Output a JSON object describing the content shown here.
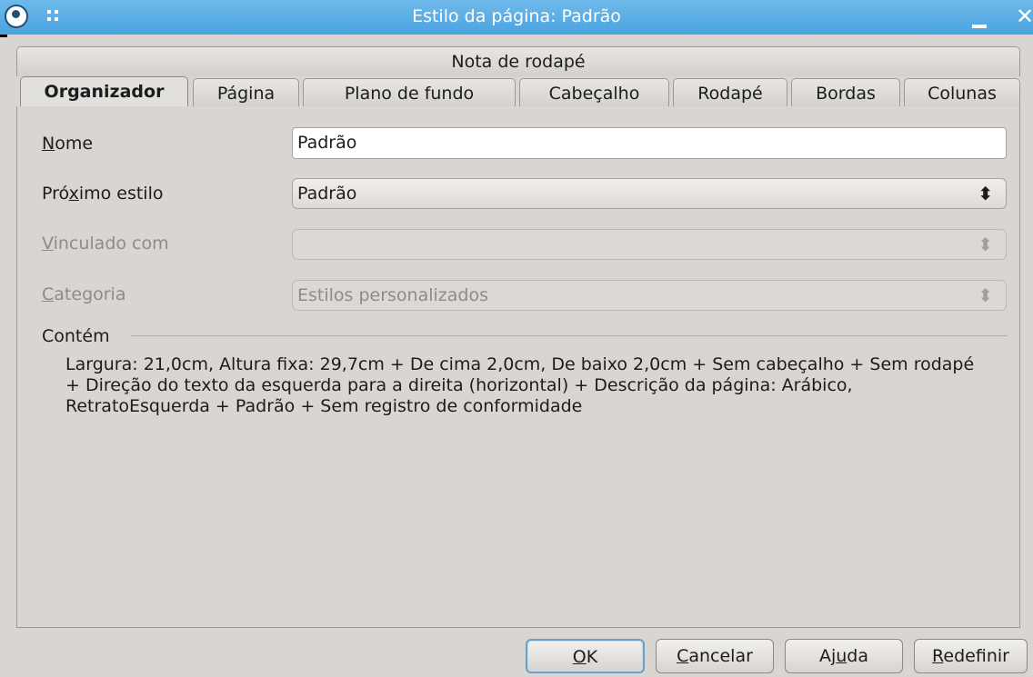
{
  "window": {
    "title": "Estilo da página: Padrão",
    "icons": {
      "app": "app-logo-icon",
      "menu": "window-menu-icon",
      "minimize": "minimize-icon",
      "close": "close-icon"
    },
    "close_glyph": "✕"
  },
  "tabs": {
    "row1": [
      {
        "label": "Nota de rodapé"
      }
    ],
    "row2": [
      {
        "label": "Organizador",
        "active": true
      },
      {
        "label": "Página"
      },
      {
        "label": "Plano de fundo"
      },
      {
        "label": "Cabeçalho"
      },
      {
        "label": "Rodapé"
      },
      {
        "label": "Bordas"
      },
      {
        "label": "Colunas"
      }
    ]
  },
  "form": {
    "name": {
      "label_pre": "",
      "label_mn": "N",
      "label_post": "ome",
      "value": "Padrão"
    },
    "next_style": {
      "label_pre": "Pró",
      "label_mn": "x",
      "label_post": "imo estilo",
      "value": "Padrão"
    },
    "linked_with": {
      "label_pre": "",
      "label_mn": "V",
      "label_post": "inculado com",
      "value": "",
      "disabled": true
    },
    "category": {
      "label_pre": "",
      "label_mn": "C",
      "label_post": "ategoria",
      "value": "Estilos personalizados",
      "disabled": true
    },
    "spin_glyph": "⬍"
  },
  "contains": {
    "label": "Contém",
    "text": "Largura: 21,0cm, Altura fixa: 29,7cm + De cima 2,0cm, De baixo 2,0cm + Sem cabeçalho + Sem rodapé + Direção do texto da esquerda para a direita (horizontal) + Descrição da página: Arábico, RetratoEsquerda + Padrão + Sem registro de conformidade"
  },
  "buttons": {
    "ok": {
      "pre": "",
      "mn": "O",
      "post": "K"
    },
    "cancel": {
      "pre": "",
      "mn": "C",
      "post": "ancelar"
    },
    "help": {
      "pre": "Aj",
      "mn": "u",
      "post": "da"
    },
    "reset": {
      "pre": "",
      "mn": "R",
      "post": "edefinir"
    }
  },
  "colors": {
    "titlebar": "#4aa3e0",
    "dialog_bg": "#d9d6d2",
    "default_button_border": "#6d9ec4",
    "disabled_text": "#8c8c8c"
  }
}
